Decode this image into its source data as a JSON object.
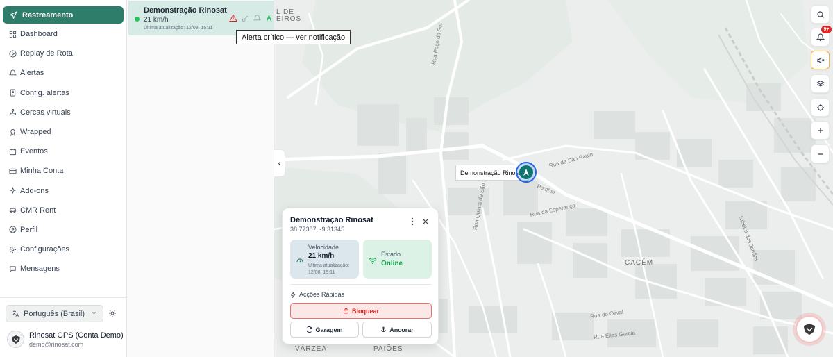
{
  "sidebar": {
    "active_item": "Rastreamento",
    "items": [
      {
        "label": "Dashboard",
        "icon": "dashboard-icon"
      },
      {
        "label": "Replay de Rota",
        "icon": "play-circle-icon"
      },
      {
        "label": "Alertas",
        "icon": "bell-icon"
      },
      {
        "label": "Config. alertas",
        "icon": "document-settings-icon"
      },
      {
        "label": "Cercas virtuais",
        "icon": "geofence-icon"
      },
      {
        "label": "Wrapped",
        "icon": "award-icon"
      },
      {
        "label": "Eventos",
        "icon": "calendar-icon"
      },
      {
        "label": "Minha Conta",
        "icon": "card-icon"
      },
      {
        "label": "Add-ons",
        "icon": "sparkle-icon"
      },
      {
        "label": "CMR Rent",
        "icon": "car-icon"
      },
      {
        "label": "Perfil",
        "icon": "user-circle-icon"
      },
      {
        "label": "Configurações",
        "icon": "gear-icon"
      },
      {
        "label": "Mensagens",
        "icon": "message-icon"
      }
    ],
    "language": "Português (Brasil)",
    "profile": {
      "name": "Rinosat GPS (Conta Demo)",
      "email": "demo@rinosat.com"
    }
  },
  "vehicle_list": {
    "items": [
      {
        "name": "Demonstração Rinosat",
        "speed": "21 km/h",
        "updated": "Última atualização: 12/08, 15:11",
        "status_color": "#22c55e"
      }
    ],
    "tooltip": "Alerta crítico — ver notificação"
  },
  "map": {
    "labels": {
      "neighborhood_top": "L DE",
      "neighborhood_top2": "EIROS",
      "cacem": "CACÉM",
      "varzea": "VÁRZEA",
      "paioes": "PAIÕES",
      "rua_poco_sol": "Rua Poço do Sol",
      "rua_esperanca": "Rua da Esperança",
      "ribeira": "Ribeira dos Jardins",
      "rua_quinta": "Rua Quinta de São Paulo",
      "rua_olival": "Rua do Olival",
      "rua_elias": "Rua Elias Garcia",
      "rua_pombal": "Pombal",
      "rua_sao_paulo": "Rua de São Paulo"
    },
    "marker_label": "Demonstração Rinosat",
    "notifications_badge": "9+"
  },
  "popup": {
    "title": "Demonstração Rinosat",
    "coords": "38.77387, -9.31345",
    "speed_label": "Velocidade",
    "speed_value": "21 km/h",
    "speed_updated": "Última atualização: 12/08, 15:11",
    "state_label": "Estado",
    "state_value": "Online",
    "quick_actions": "Acções Rápidas",
    "block_label": "Bloquear",
    "garage_label": "Garagem",
    "anchor_label": "Ancorar"
  },
  "colors": {
    "brand": "#2e7d6b",
    "online": "#16a34a",
    "danger": "#dc2626",
    "warning": "#f2b13d"
  }
}
